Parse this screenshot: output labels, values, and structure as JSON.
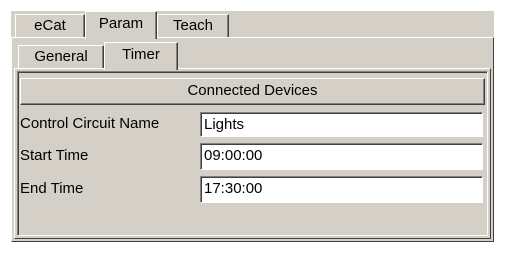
{
  "top_tabs": [
    {
      "label": "eCat"
    },
    {
      "label": "Param"
    },
    {
      "label": "Teach"
    }
  ],
  "sub_tabs": [
    {
      "label": "General"
    },
    {
      "label": "Timer"
    }
  ],
  "connected_devices_button": "Connected Devices",
  "form": {
    "control_circuit_label": "Control Circuit Name",
    "control_circuit_value": "Lights",
    "start_time_label": "Start Time",
    "start_time_value": "09:00:00",
    "end_time_label": "End Time",
    "end_time_value": "17:30:00"
  }
}
